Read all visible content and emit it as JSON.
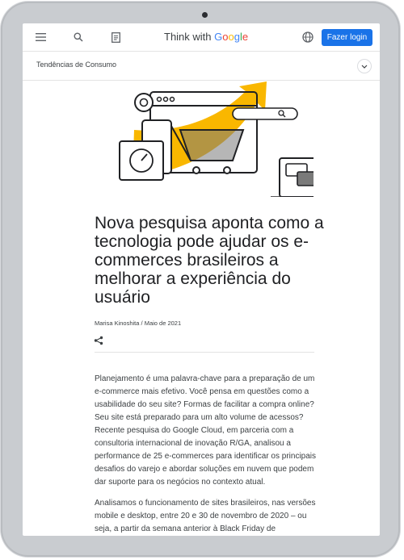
{
  "header": {
    "brand_prefix": "Think with",
    "brand_letters": [
      "G",
      "o",
      "o",
      "g",
      "l",
      "e"
    ],
    "login_label": "Fazer login",
    "icons": [
      "menu-icon",
      "search-icon",
      "article-icon",
      "globe-icon"
    ]
  },
  "subheader": {
    "category": "Tendências de Consumo"
  },
  "article": {
    "title": "Nova pesquisa aponta como a tecnologia pode ajudar os e-commerces brasileiros a melhorar a experiência do usuário",
    "byline": "Marisa Kinoshita / Maio de 2021",
    "paragraphs": [
      "Planejamento é uma palavra-chave para a preparação de um e-commerce mais efetivo. Você pensa em questões como a usabilidade do seu site? Formas de facilitar a compra online? Seu site está preparado para um alto volume de acessos? Recente pesquisa do Google Cloud, em parceria com a consultoria internacional de inovação R/GA, analisou a performance de 25 e-commerces para identificar os principais desafios do varejo e abordar soluções em nuvem que podem dar suporte para os negócios no contexto atual.",
      "Analisamos o funcionamento de sites brasileiros, nas versões mobile e desktop, entre 20 e 30 de novembro de 2020 – ou seja, a partir da semana anterior à Black Friday de"
    ]
  },
  "colors": {
    "accent": "#1a73e8",
    "hero_yellow": "#f9b700",
    "text": "#202124"
  }
}
